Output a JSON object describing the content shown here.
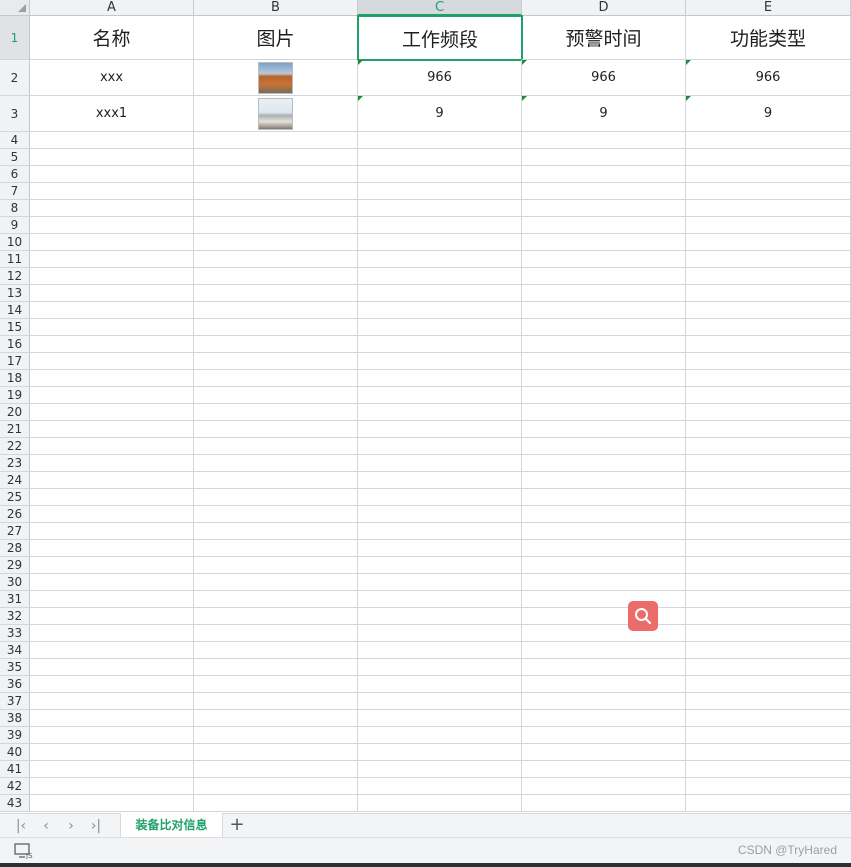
{
  "columns": [
    "A",
    "B",
    "C",
    "D",
    "E"
  ],
  "selected_column": "C",
  "selected_row": 1,
  "row_numbers": [
    "1",
    "2",
    "3",
    "4",
    "5",
    "6",
    "7",
    "8",
    "9",
    "10",
    "11",
    "12",
    "13",
    "14",
    "15",
    "16",
    "17",
    "18",
    "19",
    "20",
    "21",
    "22",
    "23",
    "24",
    "25",
    "26",
    "27",
    "28",
    "29",
    "30",
    "31",
    "32",
    "33",
    "34",
    "35",
    "36",
    "37",
    "38",
    "39",
    "40",
    "41",
    "42",
    "43"
  ],
  "header_row": [
    "名称",
    "图片",
    "工作频段",
    "预警时间",
    "功能类型"
  ],
  "rows": [
    {
      "name": "xxx",
      "image": "building-photo",
      "freq": "966",
      "warning": "966",
      "func": "966"
    },
    {
      "name": "xxx1",
      "image": "ship-photo",
      "freq": "9",
      "warning": "9",
      "func": "9"
    }
  ],
  "sheet_nav": {
    "first": "|‹",
    "prev": "‹",
    "next": "›",
    "last": "›|"
  },
  "sheet_tab": "装备比对信息",
  "add_sheet": "+",
  "search_fab_icon": "search-icon",
  "watermark": "CSDN @TryHared",
  "colors": {
    "accent": "#22a06b",
    "fab": "#ec6b6b",
    "header_bg": "#f1f2f4"
  }
}
